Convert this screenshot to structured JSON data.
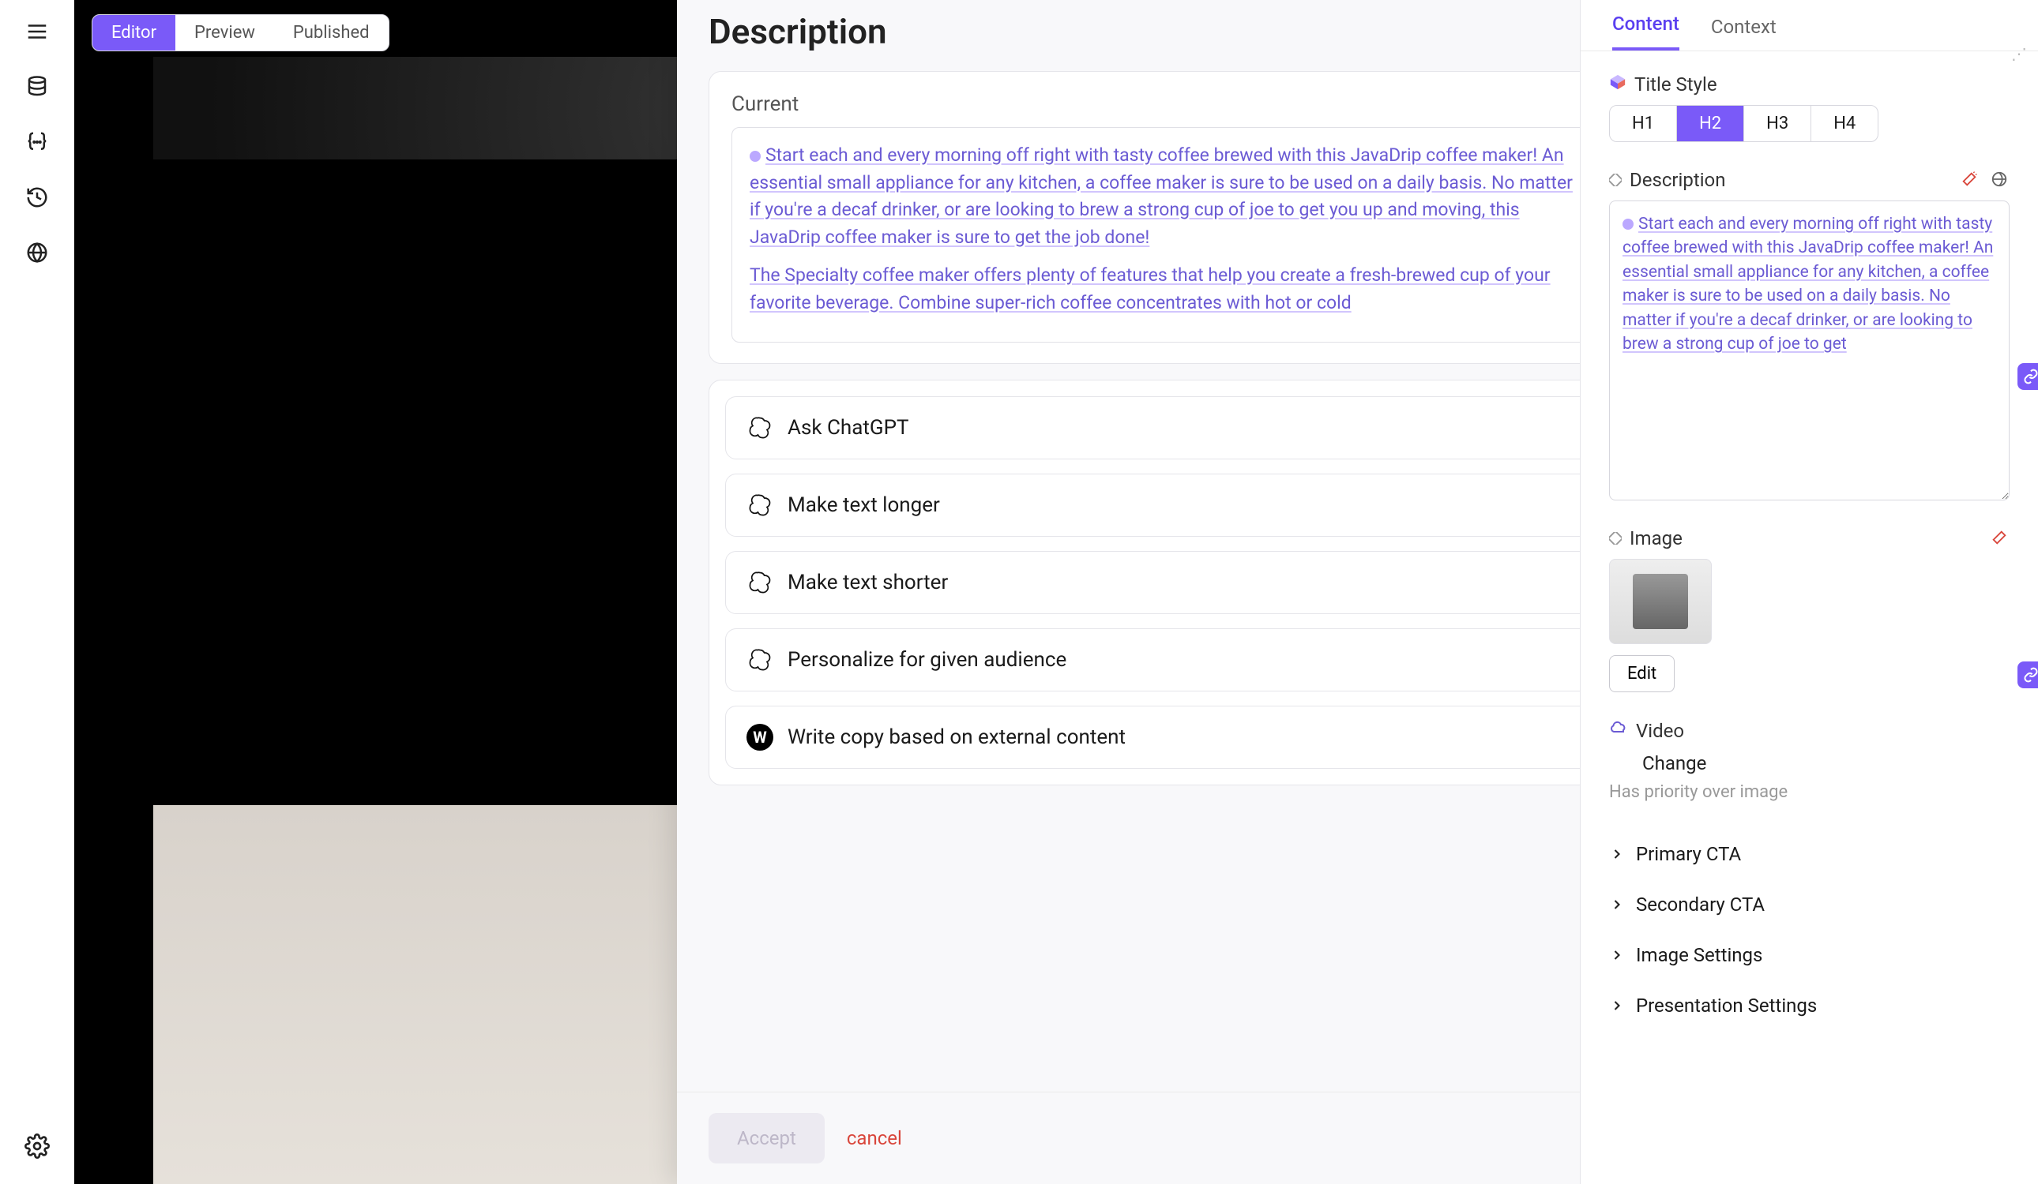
{
  "leftRail": {
    "icons": [
      "menu",
      "database",
      "braces",
      "history",
      "globe",
      "settings"
    ]
  },
  "viewTabs": {
    "editor": "Editor",
    "preview": "Preview",
    "published": "Published",
    "active": "editor"
  },
  "modal": {
    "title": "Description",
    "currentLabel": "Current",
    "currentText1": "Start each and every morning off right with tasty coffee brewed with this JavaDrip coffee maker! An essential small appliance for any kitchen, a coffee maker is sure to be used on a daily basis. No matter if you're a decaf drinker, or are looking to brew a strong cup of joe to get you up and moving, this JavaDrip coffee maker is sure to get the job done!",
    "currentText2": "The Specialty coffee maker offers plenty of features that help you create a fresh-brewed cup of your favorite beverage. Combine super-rich coffee concentrates with hot or cold",
    "actions": [
      {
        "icon": "openai",
        "label": "Ask ChatGPT"
      },
      {
        "icon": "openai",
        "label": "Make text longer"
      },
      {
        "icon": "openai",
        "label": "Make text shorter"
      },
      {
        "icon": "openai",
        "label": "Personalize for given audience"
      },
      {
        "icon": "w",
        "label": "Write copy based on external content"
      }
    ],
    "accept": "Accept",
    "cancel": "cancel"
  },
  "panel": {
    "tabs": {
      "content": "Content",
      "context": "Context",
      "active": "content"
    },
    "titleStyle": {
      "label": "Title Style",
      "options": [
        "H1",
        "H2",
        "H3",
        "H4"
      ],
      "active": "H2"
    },
    "description": {
      "label": "Description",
      "text": "Start each and every morning off right with tasty coffee brewed with this JavaDrip coffee maker! An essential small appliance for any kitchen, a coffee maker is sure to be used on a daily basis. No matter if you're a decaf drinker, or are looking to brew a strong cup of joe to get"
    },
    "image": {
      "label": "Image",
      "editLabel": "Edit"
    },
    "video": {
      "label": "Video",
      "change": "Change",
      "hint": "Has priority over image"
    },
    "accordions": [
      "Primary CTA",
      "Secondary CTA",
      "Image Settings",
      "Presentation Settings"
    ]
  }
}
